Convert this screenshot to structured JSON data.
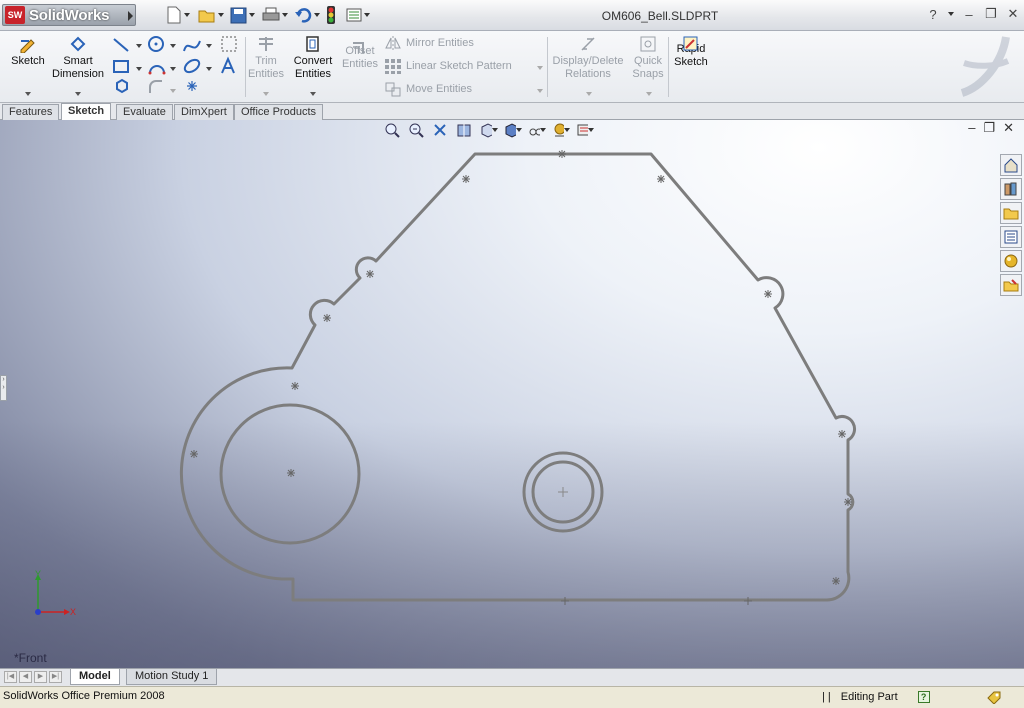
{
  "app": {
    "logo_text": "SolidWorks",
    "badge": "SW",
    "document_title": "OM606_Bell.SLDPRT"
  },
  "title_controls": {
    "help": "?",
    "minimize": "–",
    "restore": "❐",
    "close": "✕"
  },
  "command_manager": {
    "sketch": "Sketch",
    "smart_dimension": [
      "Smart",
      "Dimension"
    ],
    "trim_entities": [
      "Trim",
      "Entities"
    ],
    "convert_entities": [
      "Convert",
      "Entities"
    ],
    "offset_entities": [
      "Offset",
      "Entities"
    ],
    "mirror_entities": "Mirror Entities",
    "linear_sketch_pattern": "Linear Sketch Pattern",
    "move_entities": "Move Entities",
    "display_delete_relations": [
      "Display/Delete",
      "Relations"
    ],
    "quick_snaps": [
      "Quick",
      "Snaps"
    ],
    "rapid_sketch": [
      "Rapid",
      "Sketch"
    ]
  },
  "tabs": [
    "Features",
    "Sketch",
    "Evaluate",
    "DimXpert",
    "Office Products"
  ],
  "active_tab": "Sketch",
  "viewport": {
    "view_name": "*Front",
    "axis_x": "X",
    "axis_y": "Y"
  },
  "bottom_tabs": [
    "Model",
    "Motion Study 1"
  ],
  "status": {
    "product": "SolidWorks Office Premium 2008",
    "mode": "Editing Part",
    "separator": "| |",
    "help_icon": "?"
  },
  "colors": {
    "sketch_line": "#7d7d7d",
    "accent_red": "#c8232b"
  }
}
